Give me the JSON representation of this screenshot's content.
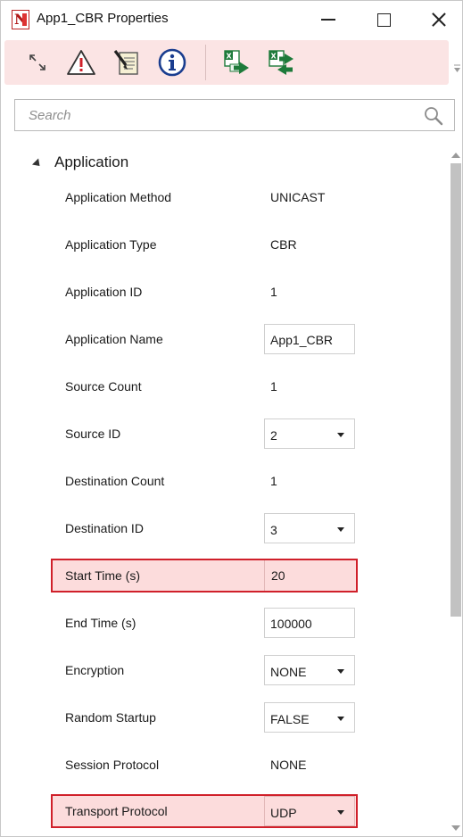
{
  "window": {
    "title": "App1_CBR Properties",
    "app_icon": "netsim-app-icon"
  },
  "title_controls": [
    "minimize-icon",
    "maximize-icon",
    "close-icon"
  ],
  "toolbar": {
    "buttons": [
      "expand-collapse-icon",
      "warning-icon",
      "edit-notes-icon",
      "info-icon",
      "excel-export-icon",
      "excel-import-icon"
    ],
    "overflow_icon": "overflow-chevron-icon"
  },
  "search": {
    "placeholder": "Search",
    "value": ""
  },
  "property_grid": {
    "category": "Application",
    "expanded": true,
    "rows": [
      {
        "label": "Application Method",
        "value": "UNICAST",
        "editor": "readonly"
      },
      {
        "label": "Application Type",
        "value": "CBR",
        "editor": "readonly"
      },
      {
        "label": "Application ID",
        "value": "1",
        "editor": "readonly"
      },
      {
        "label": "Application Name",
        "value": "App1_CBR",
        "editor": "textbox"
      },
      {
        "label": "Source Count",
        "value": "1",
        "editor": "readonly"
      },
      {
        "label": "Source ID",
        "value": "2",
        "editor": "dropdown"
      },
      {
        "label": "Destination Count",
        "value": "1",
        "editor": "readonly"
      },
      {
        "label": "Destination ID",
        "value": "3",
        "editor": "dropdown"
      },
      {
        "label": "Start Time (s)",
        "value": "20",
        "editor": "textbox",
        "highlighted": true
      },
      {
        "label": "End Time (s)",
        "value": "100000",
        "editor": "textbox"
      },
      {
        "label": "Encryption",
        "value": "NONE",
        "editor": "dropdown"
      },
      {
        "label": "Random Startup",
        "value": "FALSE",
        "editor": "dropdown"
      },
      {
        "label": "Session Protocol",
        "value": "NONE",
        "editor": "readonly"
      },
      {
        "label": "Transport Protocol",
        "value": "UDP",
        "editor": "dropdown",
        "highlighted": true
      }
    ]
  },
  "colors": {
    "toolbar_bg": "#fbe4e4",
    "highlight_bg": "#fcdcdc",
    "highlight_border": "#d0202a"
  }
}
